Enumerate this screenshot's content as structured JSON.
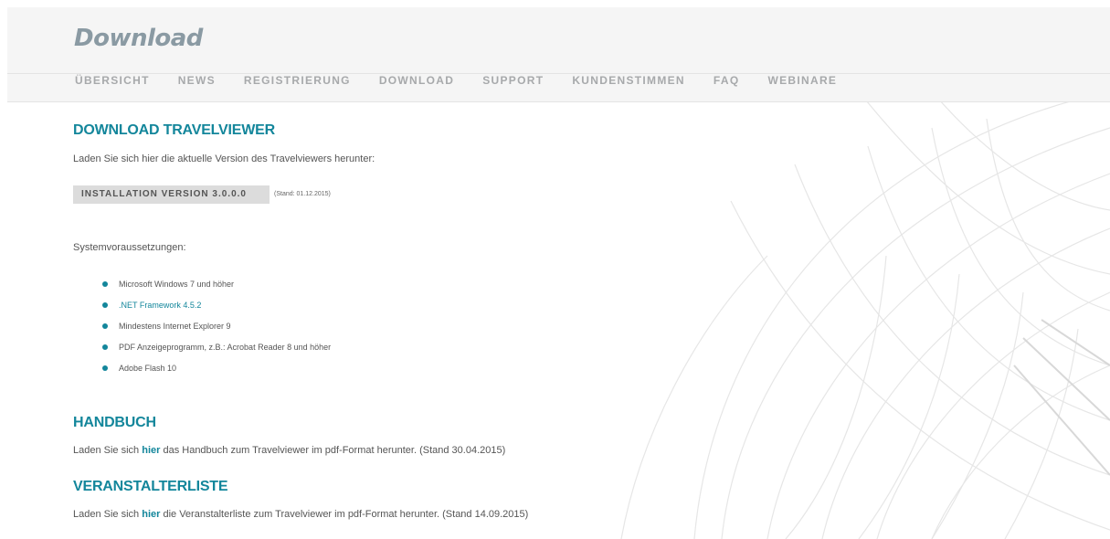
{
  "header": {
    "title": "Download",
    "nav": [
      {
        "label": "ÜBERSICHT"
      },
      {
        "label": "NEWS"
      },
      {
        "label": "REGISTRIERUNG"
      },
      {
        "label": "DOWNLOAD"
      },
      {
        "label": "SUPPORT"
      },
      {
        "label": "KUNDENSTIMMEN"
      },
      {
        "label": "FAQ"
      },
      {
        "label": "WEBINARE"
      }
    ]
  },
  "download": {
    "heading": "DOWNLOAD TRAVELVIEWER",
    "intro": "Laden Sie sich hier die aktuelle Version des Travelviewers herunter:",
    "button_label": "INSTALLATION VERSION 3.0.0.0",
    "stand": "(Stand: 01.12.2015)",
    "sys_label": "Systemvoraussetzungen:",
    "requirements": [
      {
        "text": "Microsoft Windows 7 und höher"
      },
      {
        "text": ".NET Framework 4.5.2"
      },
      {
        "text": "Mindestens Internet Explorer 9"
      },
      {
        "text": "PDF Anzeigeprogramm, z.B.: Acrobat Reader 8 und höher"
      },
      {
        "text": "Adobe Flash 10"
      }
    ]
  },
  "handbuch": {
    "heading": "HANDBUCH",
    "text_before": "Laden Sie sich ",
    "link": "hier",
    "text_after": " das Handbuch zum Travelviewer im pdf-Format herunter. (Stand 30.04.2015)"
  },
  "veranstalter": {
    "heading": "VERANSTALTERLISTE",
    "text_before": "Laden Sie sich ",
    "link": "hier",
    "text_after": " die Veranstalterliste zum Travelviewer im pdf-Format herunter. (Stand 14.09.2015)"
  },
  "colors": {
    "accent": "#13869b",
    "nav_text": "#a7a9ab",
    "title": "#8a9aa3",
    "header_bg": "#f5f5f5"
  }
}
